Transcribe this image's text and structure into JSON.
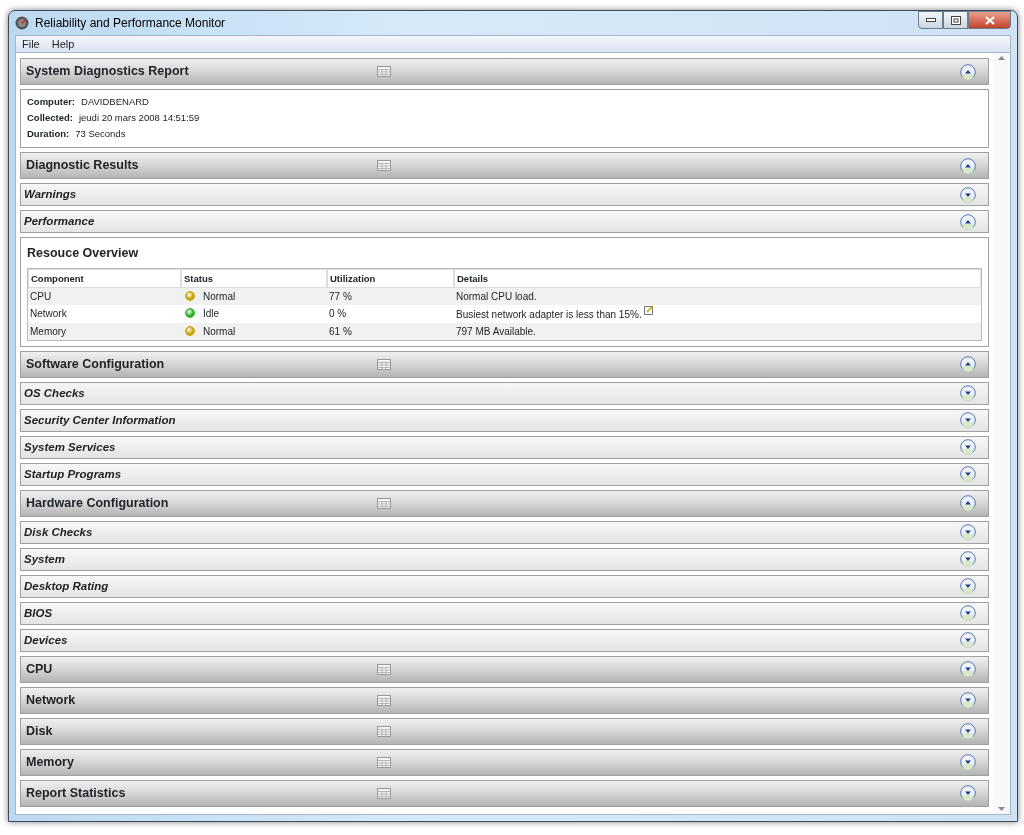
{
  "window": {
    "title": "Reliability and Performance Monitor"
  },
  "menu": [
    "File",
    "Help"
  ],
  "sections": [
    {
      "title": "System Diagnostics Report",
      "kind": "major",
      "expanded": true,
      "fields": [
        {
          "label": "Computer:",
          "value": "DAVIDBENARD"
        },
        {
          "label": "Collected:",
          "value": "jeudi 20 mars 2008 14:51:59"
        },
        {
          "label": "Duration:",
          "value": "73 Seconds"
        }
      ]
    },
    {
      "title": "Diagnostic Results",
      "kind": "major",
      "expanded": true
    },
    {
      "title": "Warnings",
      "kind": "minor",
      "expanded": false
    },
    {
      "title": "Performance",
      "kind": "minor",
      "expanded": true,
      "overview": {
        "title": "Resouce Overview",
        "columns": [
          "Component",
          "Status",
          "Utilization",
          "Details"
        ],
        "rows": [
          {
            "component": "CPU",
            "status": "Normal",
            "color": "#c9a406",
            "utilization": "77 %",
            "details": "Normal CPU load.",
            "note": false
          },
          {
            "component": "Network",
            "status": "Idle",
            "color": "#2fb12a",
            "utilization": "0 %",
            "details": "Busiest network adapter is less than 15%.",
            "note": true
          },
          {
            "component": "Memory",
            "status": "Normal",
            "color": "#c9a406",
            "utilization": "61 %",
            "details": "797 MB Available.",
            "note": false
          }
        ]
      }
    },
    {
      "title": "Software Configuration",
      "kind": "major",
      "expanded": true
    },
    {
      "title": "OS Checks",
      "kind": "minor",
      "expanded": false
    },
    {
      "title": "Security Center Information",
      "kind": "minor",
      "expanded": false
    },
    {
      "title": "System Services",
      "kind": "minor",
      "expanded": false
    },
    {
      "title": "Startup Programs",
      "kind": "minor",
      "expanded": false
    },
    {
      "title": "Hardware Configuration",
      "kind": "major",
      "expanded": true
    },
    {
      "title": "Disk Checks",
      "kind": "minor",
      "expanded": false
    },
    {
      "title": "System",
      "kind": "minor",
      "expanded": false
    },
    {
      "title": "Desktop Rating",
      "kind": "minor",
      "expanded": false
    },
    {
      "title": "BIOS",
      "kind": "minor",
      "expanded": false
    },
    {
      "title": "Devices",
      "kind": "minor",
      "expanded": false
    },
    {
      "title": "CPU",
      "kind": "major",
      "expanded": false
    },
    {
      "title": "Network",
      "kind": "major",
      "expanded": false
    },
    {
      "title": "Disk",
      "kind": "major",
      "expanded": false
    },
    {
      "title": "Memory",
      "kind": "major",
      "expanded": false
    },
    {
      "title": "Report Statistics",
      "kind": "major",
      "expanded": false
    }
  ]
}
